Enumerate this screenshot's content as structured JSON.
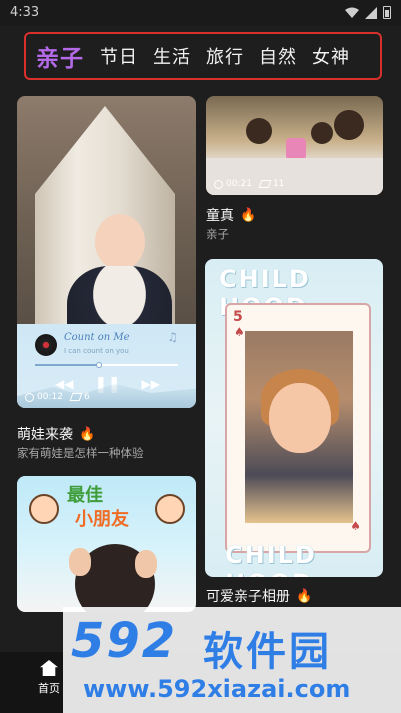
{
  "status_bar": {
    "time": "4:33"
  },
  "tabs": [
    {
      "label": "亲子",
      "active": true
    },
    {
      "label": "节日",
      "active": false
    },
    {
      "label": "生活",
      "active": false
    },
    {
      "label": "旅行",
      "active": false
    },
    {
      "label": "自然",
      "active": false
    },
    {
      "label": "女神",
      "active": false
    }
  ],
  "colors": {
    "accent": "#b46ae6",
    "highlight_border": "#d8312b",
    "watermark": "#2f7ee6"
  },
  "cards": {
    "card1": {
      "title": "萌娃来袭",
      "subtitle": "家有萌娃是怎样一种体验",
      "duration": "00:12",
      "clips": "6",
      "song_title": "Count on Me",
      "lyric": "I can count on you",
      "progress": 0.45
    },
    "card2": {
      "title": "童真",
      "subtitle": "亲子",
      "duration": "00:21",
      "clips": "11"
    },
    "card3": {
      "title": "可爱亲子相册",
      "hood_top": "CHILD HOOD",
      "hood_bottom": "CHILD HOOD",
      "suit": "5"
    },
    "card4": {
      "banner_line1": "最佳",
      "banner_line2": "小朋友"
    }
  },
  "bottom_nav": {
    "home_label": "首页"
  },
  "watermark": {
    "brand_num": "592",
    "brand_cn": "软件园",
    "url": "www.592xiazai.com"
  }
}
